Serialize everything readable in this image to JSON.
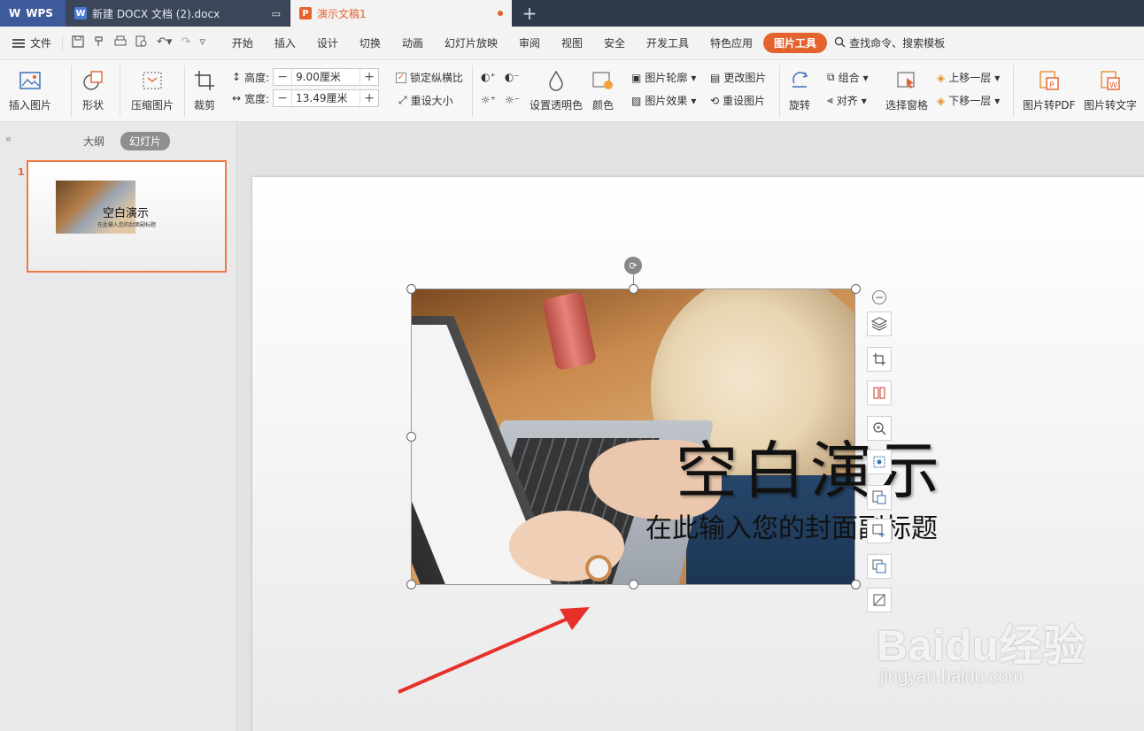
{
  "titlebar": {
    "app_tab": "WPS",
    "doc_tab": "新建 DOCX 文档 (2).docx",
    "ppt_tab": "演示文稿1",
    "new_tab": "+"
  },
  "menubar": {
    "file": "文件",
    "items": [
      "开始",
      "插入",
      "设计",
      "切换",
      "动画",
      "幻灯片放映",
      "审阅",
      "视图",
      "安全",
      "开发工具",
      "特色应用"
    ],
    "active_item": "图片工具",
    "search": "查找命令、搜索模板"
  },
  "ribbon": {
    "insert_picture": "插入图片",
    "shape": "形状",
    "compress": "压缩图片",
    "crop": "裁剪",
    "height_label": "高度:",
    "height_value": "9.00厘米",
    "width_label": "宽度:",
    "width_value": "13.49厘米",
    "lock_ratio": "锁定纵横比",
    "reset_size": "重设大小",
    "set_transparent": "设置透明色",
    "color": "颜色",
    "picture_outline": "图片轮廓",
    "picture_effect": "图片效果",
    "change_picture": "更改图片",
    "reset_picture": "重设图片",
    "rotate": "旋转",
    "group": "组合",
    "align": "对齐",
    "selection_pane": "选择窗格",
    "bring_forward": "上移一层",
    "send_backward": "下移一层",
    "to_pdf": "图片转PDF",
    "to_text": "图片转文字"
  },
  "left_panel": {
    "collapse": "«",
    "tab_outline": "大纲",
    "tab_slides": "幻灯片",
    "slide_number": "1",
    "thumb_title": "空白演示",
    "thumb_subtitle": "在此输入您的封面副标题"
  },
  "slide": {
    "title": "空白演示",
    "subtitle": "在此输入您的封面副标题"
  },
  "watermark": {
    "brand": "Baidu经验",
    "url": "jingyan.baidu.com"
  },
  "colors": {
    "accent": "#e4622e",
    "titlebar": "#2f3a4b",
    "annotation_arrow": "#e8302a"
  }
}
